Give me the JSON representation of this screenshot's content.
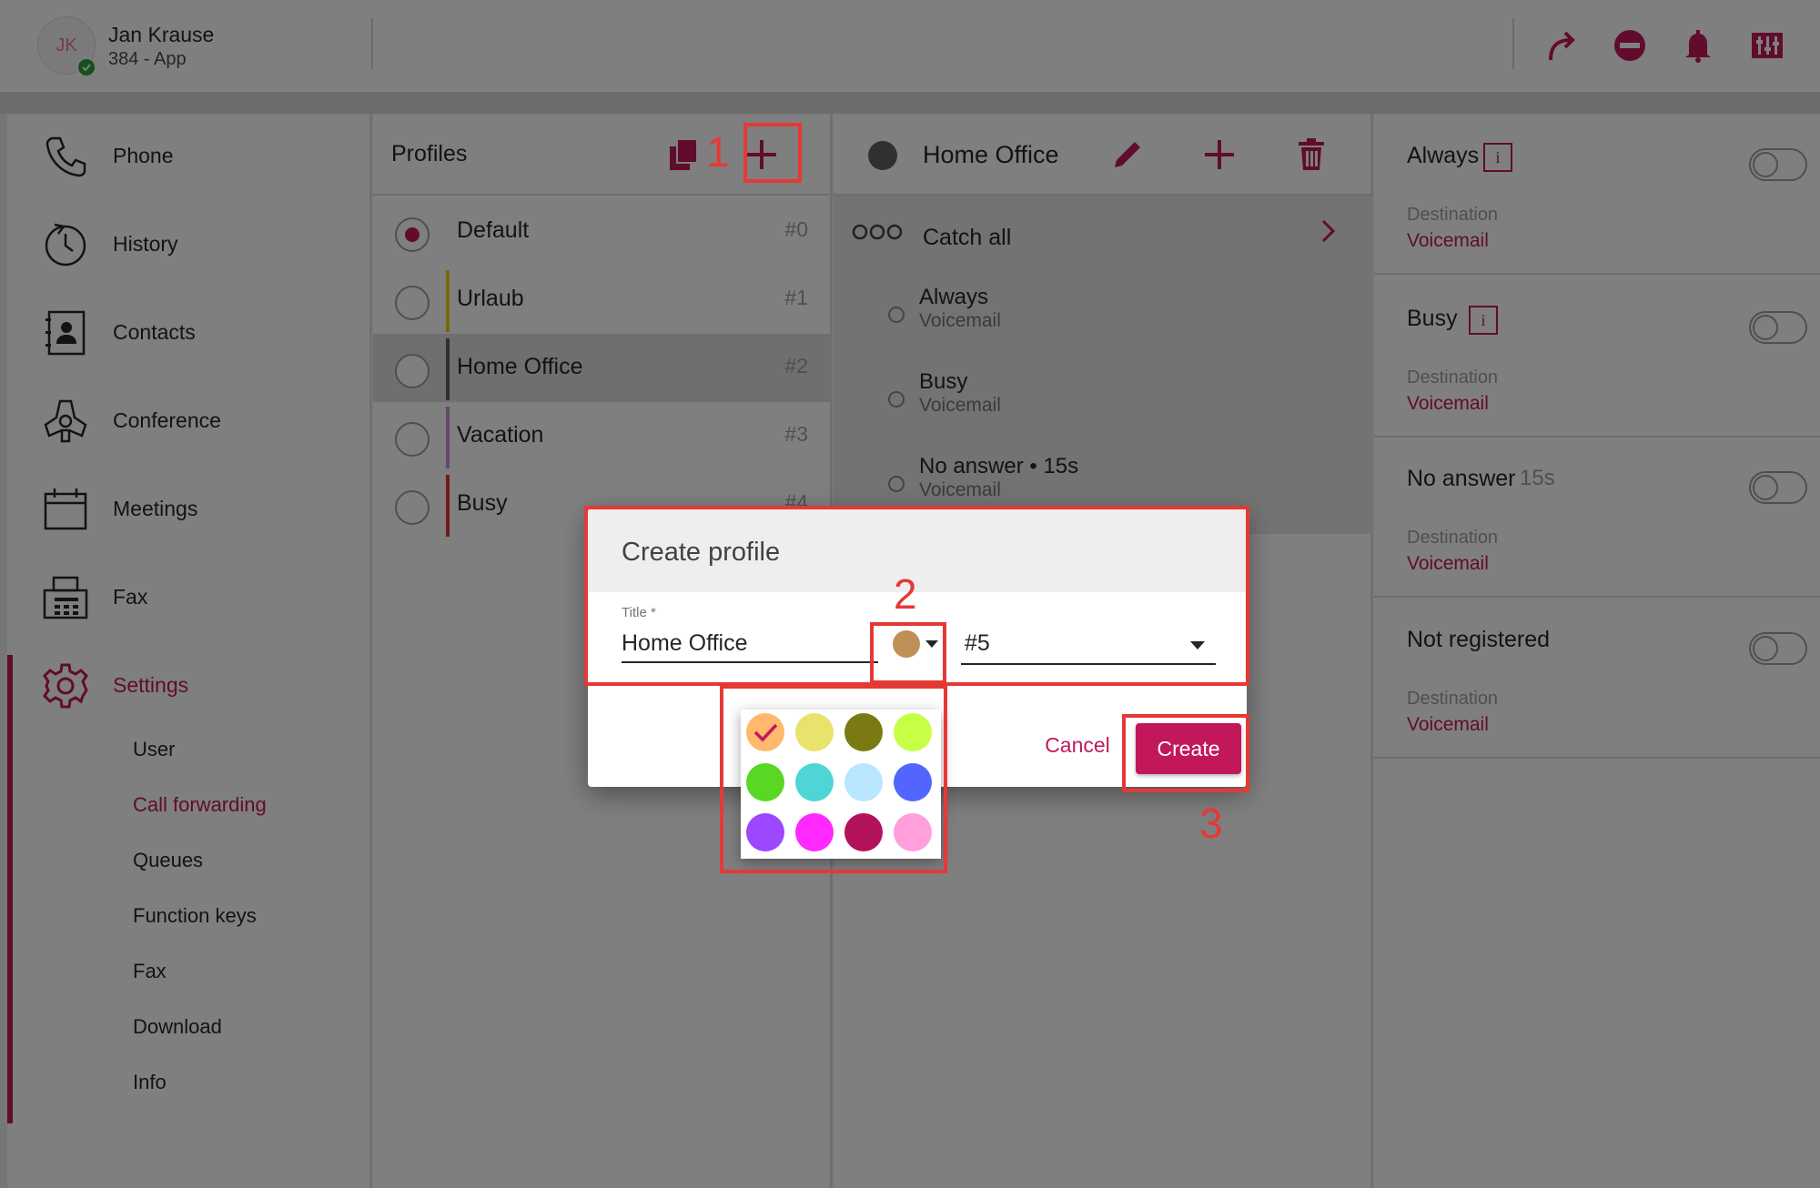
{
  "user": {
    "initials": "JK",
    "name": "Jan Krause",
    "extension": "384 - App"
  },
  "topbar_icons": [
    "forward-icon",
    "dnd-icon",
    "bell-icon",
    "mixer-icon"
  ],
  "nav": {
    "items": [
      {
        "label": "Phone",
        "icon": "phone-icon"
      },
      {
        "label": "History",
        "icon": "history-icon"
      },
      {
        "label": "Contacts",
        "icon": "contacts-icon"
      },
      {
        "label": "Conference",
        "icon": "conference-icon"
      },
      {
        "label": "Meetings",
        "icon": "meetings-icon"
      },
      {
        "label": "Fax",
        "icon": "fax-icon"
      },
      {
        "label": "Settings",
        "icon": "gear-icon"
      }
    ],
    "settings_sub": [
      "User",
      "Call forwarding",
      "Queues",
      "Function keys",
      "Fax",
      "Download",
      "Info"
    ],
    "active_sub": "Call forwarding"
  },
  "profiles": {
    "title": "Profiles",
    "items": [
      {
        "name": "Default",
        "num": "#0",
        "color": "#ffffff"
      },
      {
        "name": "Urlaub",
        "num": "#1",
        "color": "#e6d800"
      },
      {
        "name": "Home Office",
        "num": "#2",
        "color": "#616161"
      },
      {
        "name": "Vacation",
        "num": "#3",
        "color": "#ce93d8"
      },
      {
        "name": "Busy",
        "num": "#4",
        "color": "#e53935"
      }
    ]
  },
  "detail": {
    "title": "Home Office",
    "catch_all": "Catch all",
    "rules": [
      {
        "name": "Always",
        "dest": "Voicemail"
      },
      {
        "name": "Busy",
        "dest": "Voicemail"
      },
      {
        "name": "No answer • 15s",
        "dest": "Voicemail"
      }
    ]
  },
  "conditions": [
    {
      "name": "Always",
      "extra": "",
      "info": "i",
      "label": "Destination",
      "dest": "Voicemail"
    },
    {
      "name": "Busy",
      "extra": "",
      "info": "i",
      "label": "Destination",
      "dest": "Voicemail"
    },
    {
      "name": "No answer",
      "extra": "15s",
      "info": "",
      "label": "Destination",
      "dest": "Voicemail"
    },
    {
      "name": "Not registered",
      "extra": "",
      "info": "",
      "label": "Destination",
      "dest": "Voicemail"
    }
  ],
  "dialog": {
    "title": "Create profile",
    "title_label": "Title *",
    "title_value": "Home Office",
    "selected_color": "#bf8f57",
    "number_value": "#5",
    "cancel": "Cancel",
    "create": "Create"
  },
  "palette": [
    "#ffb86c",
    "#e8e36c",
    "#7a7a13",
    "#c6ff45",
    "#5ad723",
    "#4fd5d6",
    "#b9e6ff",
    "#5266ff",
    "#9d47ff",
    "#ff29ff",
    "#b3115a",
    "#ff9fdb"
  ],
  "steps": [
    "1",
    "2",
    "3"
  ],
  "colors": {
    "accent": "#c2185b",
    "highlight": "#e53935"
  }
}
